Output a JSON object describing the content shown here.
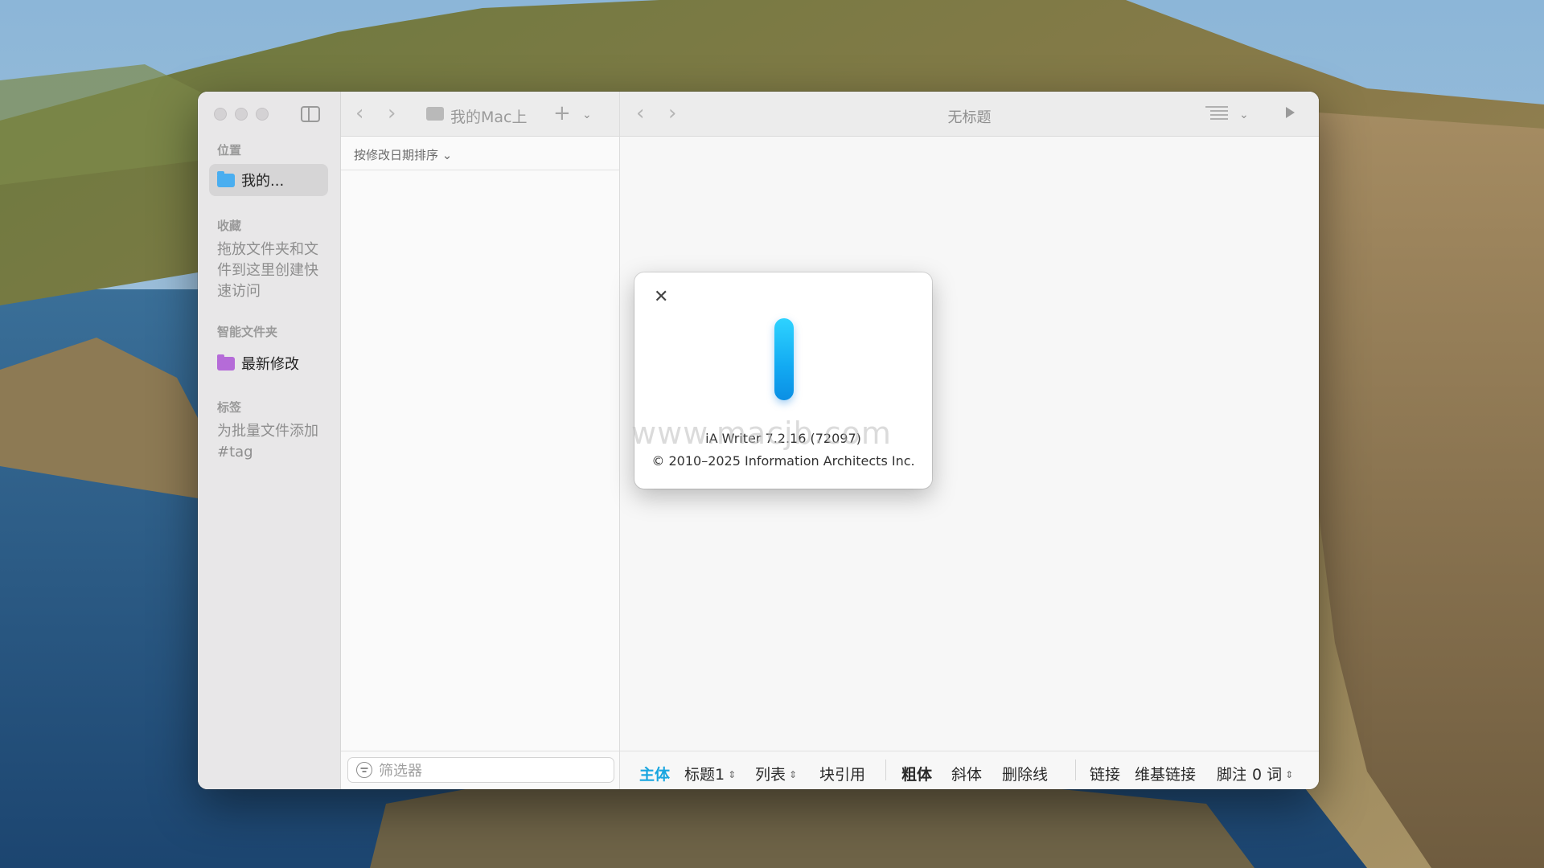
{
  "sidebar": {
    "sections": {
      "locations": "位置",
      "favorites": "收藏",
      "smart_folders": "智能文件夹",
      "tags": "标签"
    },
    "location_item": "我的...",
    "favorites_hint": "拖放文件夹和文件到这里创建快速访问",
    "smart_item": "最新修改",
    "tags_hint": "为批量文件添加#tag"
  },
  "file_column": {
    "location": "我的Mac上",
    "sort_label": "按修改日期排序 ⌄",
    "filter_placeholder": "筛选器"
  },
  "editor": {
    "title": "无标题",
    "format_bar": {
      "body": "主体",
      "heading": "标题1",
      "list": "列表",
      "blockquote": "块引用",
      "bold": "粗体",
      "italic": "斜体",
      "strikethrough": "删除线",
      "link": "链接",
      "wikilink": "维基链接",
      "footnote": "脚注",
      "word_count": "0 词"
    }
  },
  "about": {
    "version": "iA Writer 7.2.16 (72097)",
    "copyright": "© 2010–2025 Information Architects Inc."
  },
  "watermark": "www.macjb.com",
  "colors": {
    "accent": "#1aa6e0",
    "logo": "#12a9f2"
  }
}
